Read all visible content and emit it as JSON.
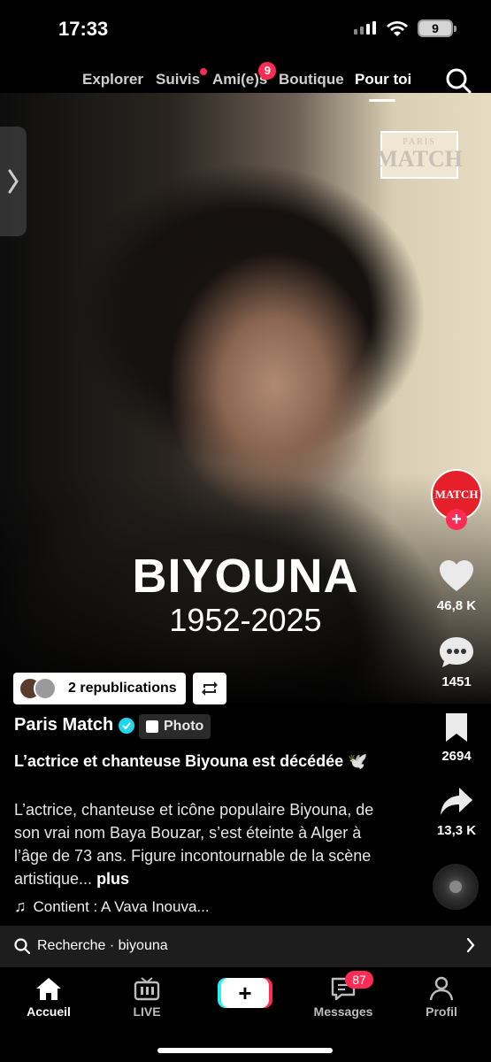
{
  "status_bar": {
    "time": "17:33",
    "battery": "9"
  },
  "top_nav": {
    "tabs": [
      {
        "label": "Explorer"
      },
      {
        "label": "Suivis"
      },
      {
        "label": "Ami(e)s",
        "badge": "9"
      },
      {
        "label": "Boutique"
      },
      {
        "label": "Pour toi"
      }
    ]
  },
  "post": {
    "logo_top": "PARIS",
    "logo_bottom": "MATCH",
    "headline": "BIYOUNA",
    "years": "1952-2025",
    "avatar_text": "MATCH",
    "likes": "46,8 K",
    "comments": "1451",
    "bookmarks": "2694",
    "shares": "13,3 K",
    "republications": "2 republications",
    "author": "Paris Match",
    "type_tag": "Photo",
    "title": "L’actrice et chanteuse Biyouna est décédée 🕊️",
    "description": "L’actrice, chanteuse et icône populaire Biyouna, de son vrai nom Baya Bouzar, s’est éteinte à Alger à l’âge de 73 ans. Figure incontournable de la scène artistique...",
    "more_label": "plus",
    "sound": "Contient : A Vava Inouva..."
  },
  "search_suggestion": "Recherche · biyouna",
  "bottom_nav": {
    "home": "Accueil",
    "live": "LIVE",
    "create": "+",
    "messages": "Messages",
    "messages_badge": "87",
    "profile": "Profil"
  },
  "colors": {
    "accent": "#fe2c55",
    "cyan": "#25f4ee",
    "verified": "#20d5ec"
  }
}
